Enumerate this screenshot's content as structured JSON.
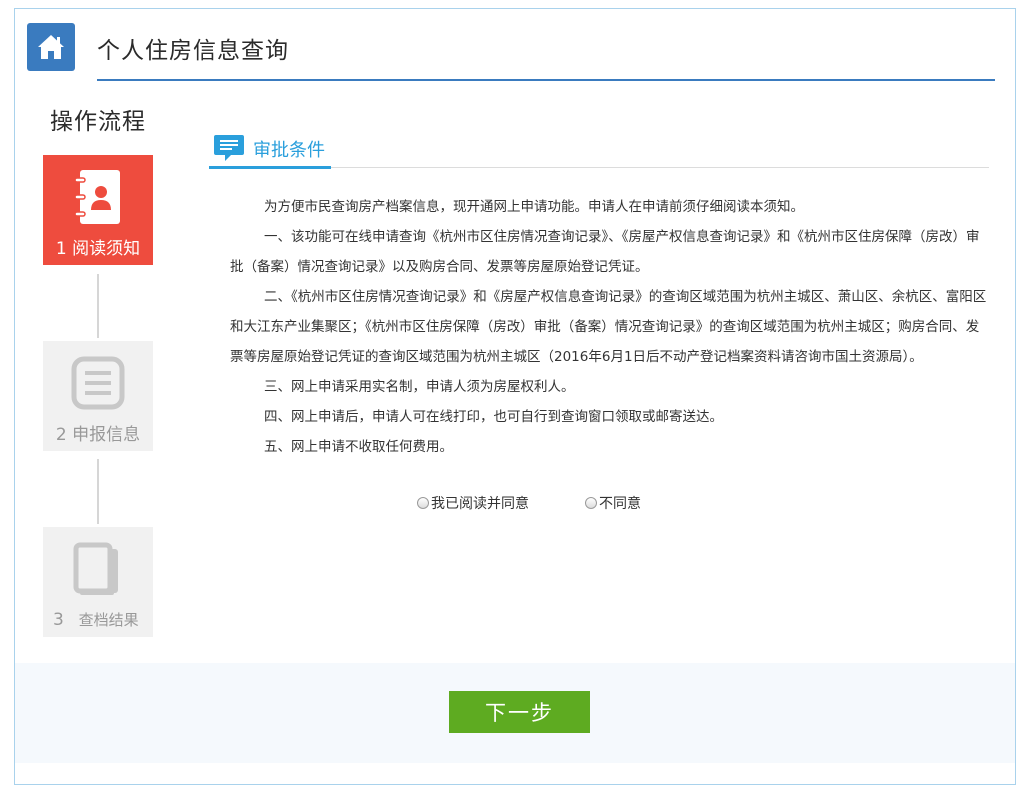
{
  "header": {
    "home_icon": "home-icon",
    "title": "个人住房信息查询"
  },
  "sidebar": {
    "title": "操作流程",
    "steps": [
      {
        "number": "1",
        "label": "阅读须知",
        "icon": "contacts-book-icon",
        "status": "active"
      },
      {
        "number": "2",
        "label": "申报信息",
        "icon": "document-list-icon",
        "status": "inactive"
      },
      {
        "number": "3",
        "label": "查档结果",
        "icon": "book-icon",
        "status": "inactive"
      }
    ]
  },
  "conditions": {
    "icon": "speech-bubble-icon",
    "title": "审批条件",
    "paragraphs": [
      "为方便市民查询房产档案信息，现开通网上申请功能。申请人在申请前须仔细阅读本须知。",
      "一、该功能可在线申请查询《杭州市区住房情况查询记录》、《房屋产权信息查询记录》和《杭州市区住房保障（房改）审批（备案）情况查询记录》以及购房合同、发票等房屋原始登记凭证。",
      "二、《杭州市区住房情况查询记录》和《房屋产权信息查询记录》的查询区域范围为杭州主城区、萧山区、余杭区、富阳区和大江东产业集聚区；《杭州市区住房保障（房改）审批（备案）情况查询记录》的查询区域范围为杭州主城区；购房合同、发票等房屋原始登记凭证的查询区域范围为杭州主城区（2016年6月1日后不动产登记档案资料请咨询市国土资源局）。",
      "三、网上申请采用实名制，申请人须为房屋权利人。",
      "四、网上申请后，申请人可在线打印，也可自行到查询窗口领取或邮寄送达。",
      "五、网上申请不收取任何费用。"
    ]
  },
  "agreement": {
    "agree_label": "我已阅读并同意",
    "disagree_label": "不同意",
    "selected": "none"
  },
  "actions": {
    "next_label": "下一步"
  },
  "colors": {
    "primary_blue": "#3a7bbf",
    "accent_blue": "#2a9fdc",
    "active_step": "#ee4c3e",
    "next_button": "#5eab21"
  }
}
